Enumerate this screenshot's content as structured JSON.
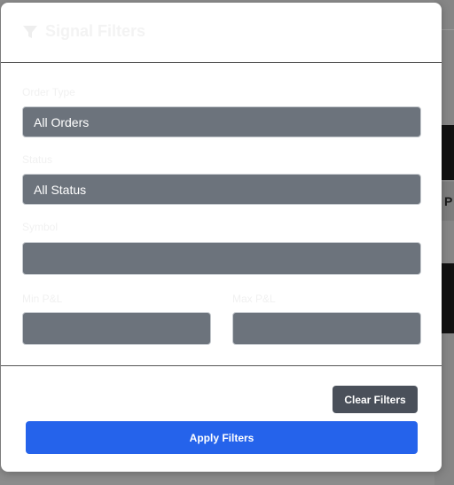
{
  "modal": {
    "title": "Signal Filters",
    "icon": "filter-icon"
  },
  "fields": {
    "order_type": {
      "label": "Order Type",
      "value": "All Orders"
    },
    "status": {
      "label": "Status",
      "value": "All Status"
    },
    "symbol": {
      "label": "Symbol",
      "value": ""
    },
    "min_pnl": {
      "label": "Min P&L",
      "value": ""
    },
    "max_pnl": {
      "label": "Max P&L",
      "value": ""
    }
  },
  "buttons": {
    "clear": "Clear Filters",
    "apply": "Apply Filters"
  },
  "background": {
    "cell_text": "P"
  },
  "colors": {
    "field_bg": "#6c737c",
    "clear_button": "#4a505a",
    "apply_button": "#2563eb"
  }
}
